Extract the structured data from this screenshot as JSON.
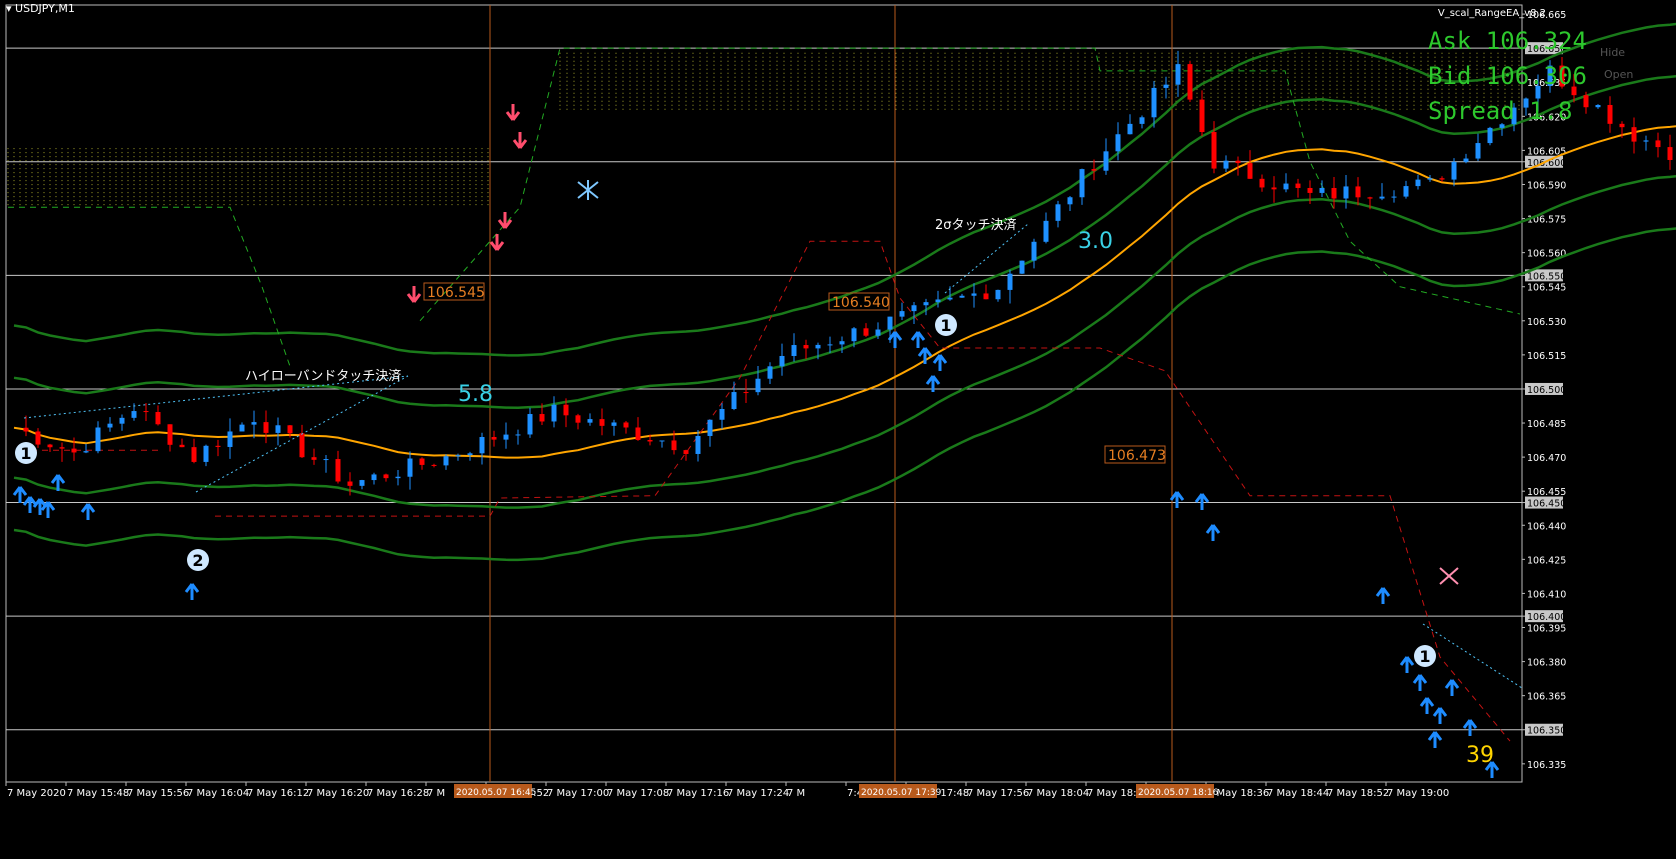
{
  "header": {
    "symbol": "USDJPY,M1",
    "ea_name": "V_scal_RangeEA_v8.2",
    "ask_label": "Ask 106.324",
    "bid_label": "Bid 106.306",
    "spread_label": "Spread 1.8",
    "hide_label": "Hide",
    "open_label": "Open"
  },
  "chart_data": {
    "type": "candlestick",
    "symbol": "USDJPY",
    "timeframe": "M1",
    "ylim": [
      106.327,
      106.669
    ],
    "price_ticks": [
      "106.665",
      "106.650",
      "106.635",
      "106.620",
      "106.605",
      "106.600",
      "106.590",
      "106.575",
      "106.560",
      "106.550",
      "106.545",
      "106.530",
      "106.515",
      "106.500",
      "106.485",
      "106.470",
      "106.455",
      "106.450",
      "106.440",
      "106.425",
      "106.410",
      "106.400",
      "106.395",
      "106.380",
      "106.365",
      "106.350",
      "106.335"
    ],
    "highlighted_prices": [
      "106.650",
      "106.600",
      "106.550",
      "106.500",
      "106.450",
      "106.400",
      "106.350"
    ],
    "time_ticks": [
      "7 May 2020",
      "7 May 15:48",
      "7 May 15:56",
      "7 May 16:04",
      "7 May 16:12",
      "7 May 16:20",
      "7 May 16:28",
      "7 M",
      "7 May 16:52",
      "7 May 17:00",
      "7 May 17:08",
      "7 May 17:16",
      "7 May 17:24",
      "7 M",
      "7:40",
      "7 May 17:48",
      "7 May 17:56",
      "7 May 18:04",
      "7 May 18:20",
      "7 May 18:28",
      "7 May 18:36",
      "7 May 18:44",
      "7 May 18:52",
      "7 May 19:00"
    ],
    "time_markers": [
      "2020.05.07 16:45",
      "2020.05.07 17:39",
      "2020.05.07 18:16"
    ],
    "price_labels": [
      "106.545",
      "106.540",
      "106.473"
    ],
    "annotations": [
      "ハイローバンドタッチ決済",
      "2σタッチ決済",
      "5.8",
      "3.0",
      "39",
      "1",
      "2",
      "1",
      "1"
    ],
    "colors": {
      "up": "#1e90ff",
      "down": "#ff0000",
      "ma": "#ffa500",
      "band": "#1a7a1a",
      "level": "#c8c8c8",
      "marker": "#b85a1c"
    }
  }
}
